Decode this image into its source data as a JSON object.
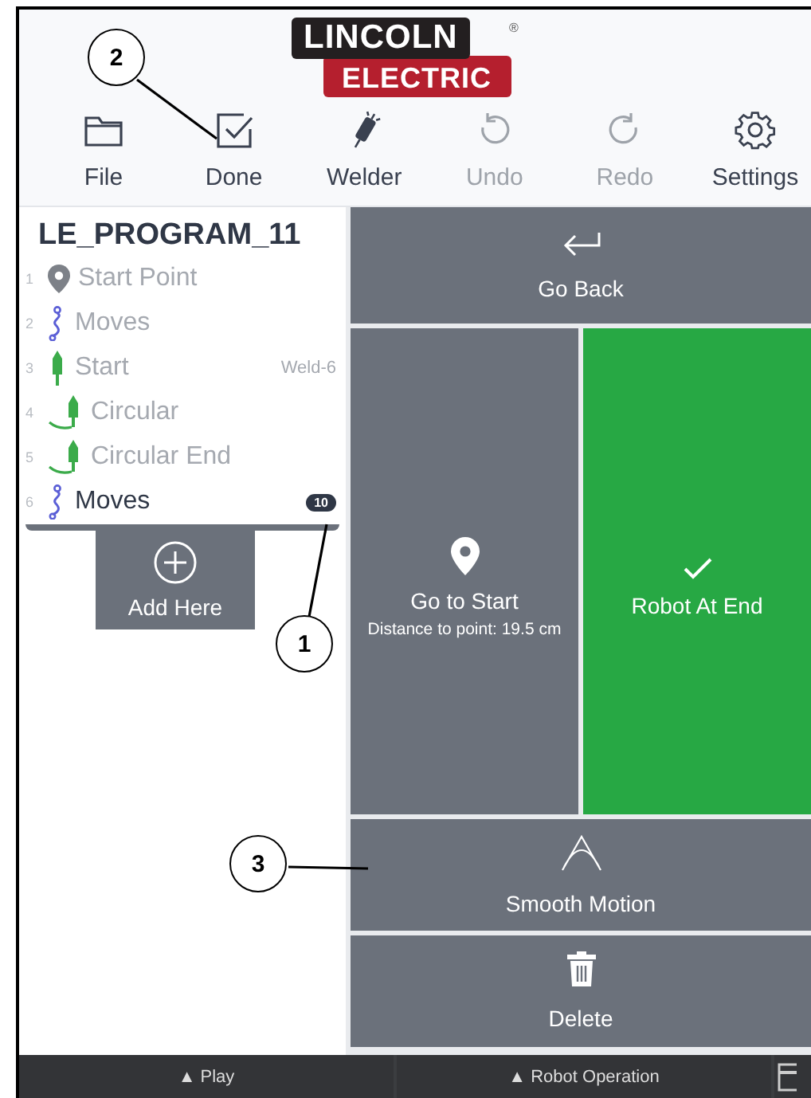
{
  "logo": {
    "top": "LINCOLN",
    "bottom": "ELECTRIC",
    "mark": "®"
  },
  "toolbar": [
    {
      "label": "File",
      "kind": "folder",
      "disabled": false
    },
    {
      "label": "Done",
      "kind": "check",
      "disabled": false
    },
    {
      "label": "Welder",
      "kind": "welder",
      "disabled": false
    },
    {
      "label": "Undo",
      "kind": "undo",
      "disabled": true
    },
    {
      "label": "Redo",
      "kind": "redo",
      "disabled": true
    },
    {
      "label": "Settings",
      "kind": "gear",
      "disabled": false
    }
  ],
  "program": {
    "title": "LE_PROGRAM_11",
    "steps": [
      {
        "number": "1",
        "label": "Start Point",
        "kind": "point",
        "selected": false
      },
      {
        "number": "2",
        "label": "Moves",
        "kind": "moves",
        "selected": false
      },
      {
        "number": "3",
        "label": "Start",
        "kind": "weld",
        "tag": "Weld-6",
        "selected": false
      },
      {
        "number": "4",
        "label": "Circular",
        "kind": "circular",
        "selected": false
      },
      {
        "number": "5",
        "label": "Circular End",
        "kind": "circular",
        "selected": false
      },
      {
        "number": "6",
        "label": "Moves",
        "kind": "moves",
        "badge": "10",
        "selected": true
      }
    ],
    "add_button": "Add Here"
  },
  "actions": [
    {
      "kind": "back",
      "label": "Go Back"
    },
    {
      "kind": "start",
      "label": "Go to Start",
      "detail": "Distance to point: 19.5 cm",
      "active": false
    },
    {
      "kind": "end",
      "label": "Robot At End",
      "active": true
    },
    {
      "kind": "smooth",
      "label": "Smooth Motion"
    },
    {
      "kind": "delete",
      "label": "Delete"
    }
  ],
  "bottom_bar": [
    {
      "label": "▲ Play"
    },
    {
      "label": "▲ Robot Operation"
    }
  ],
  "callouts": [
    "1",
    "2",
    "3"
  ]
}
